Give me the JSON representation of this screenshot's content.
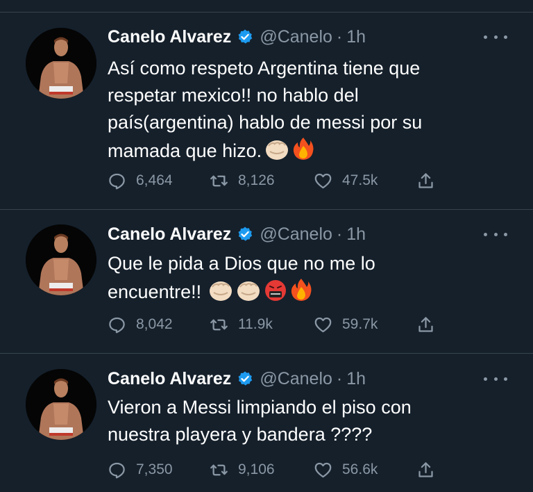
{
  "tweets": [
    {
      "author": "Canelo Alvarez",
      "handle": "@Canelo",
      "separator": "·",
      "time": "1h",
      "lines": [
        "Así como respeto Argentina tiene que",
        "respetar mexico!! no hablo del",
        "país(argentina) hablo de messi por su",
        "mamada que hizo."
      ],
      "emojis": [
        "fist-emoji",
        "fire-emoji"
      ],
      "replies": "6,464",
      "retweets": "8,126",
      "likes": "47.5k"
    },
    {
      "author": "Canelo Alvarez",
      "handle": "@Canelo",
      "separator": "·",
      "time": "1h",
      "lines": [
        "Que le pida a Dios que no me lo",
        "encuentre!!"
      ],
      "emojis": [
        "fist-emoji",
        "fist-emoji",
        "cursing-face-emoji",
        "fire-emoji"
      ],
      "replies": "8,042",
      "retweets": "11.9k",
      "likes": "59.7k"
    },
    {
      "author": "Canelo Alvarez",
      "handle": "@Canelo",
      "separator": "·",
      "time": "1h",
      "lines": [
        "Vieron a Messi limpiando el piso con",
        "nuestra playera y bandera ????"
      ],
      "emojis": [],
      "replies": "7,350",
      "retweets": "9,106",
      "likes": "56.6k"
    }
  ],
  "icons": {
    "verified": "verified-badge-icon",
    "more": "more-options-icon",
    "reply": "reply-icon",
    "retweet": "retweet-icon",
    "like": "like-icon",
    "share": "share-icon"
  },
  "colors": {
    "background": "#15202b",
    "text": "#ffffff",
    "secondary": "#8b98a5",
    "divider": "#38444d",
    "verified": "#1d9bf0"
  }
}
